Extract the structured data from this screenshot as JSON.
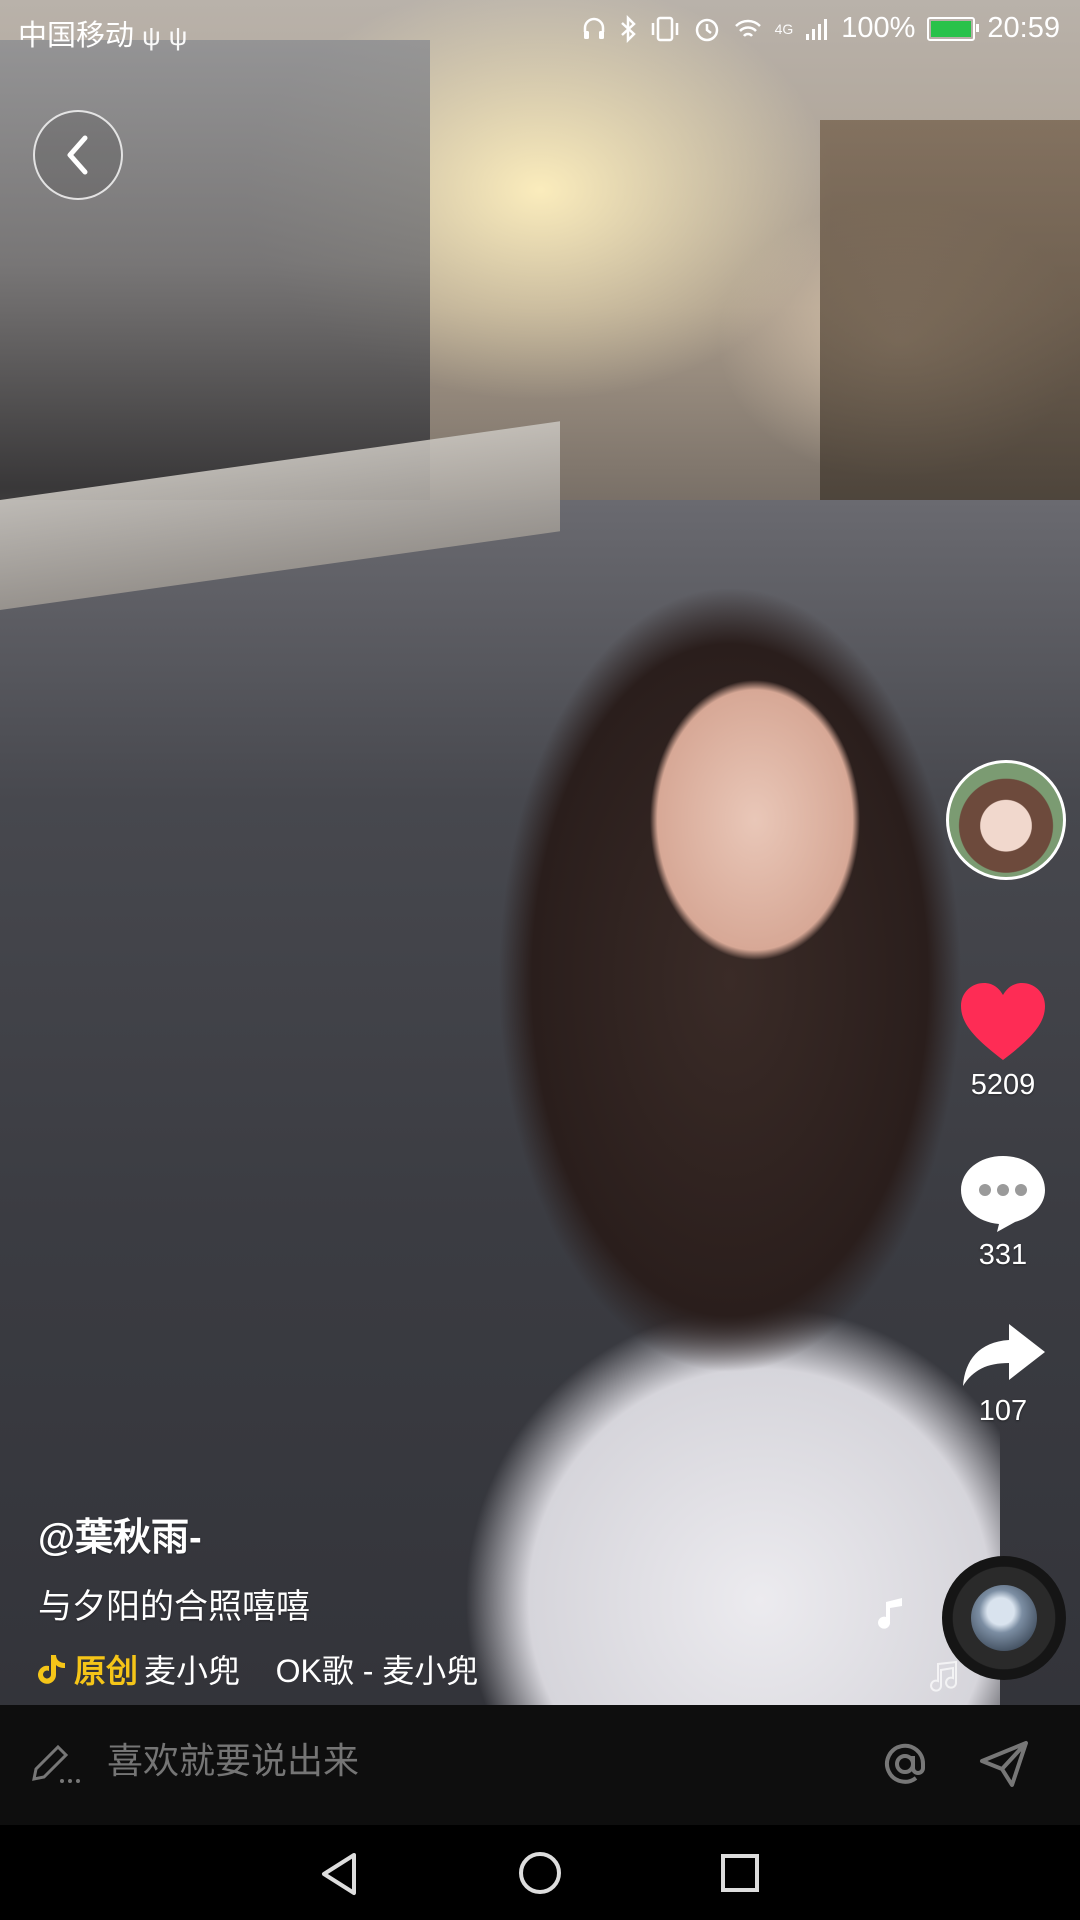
{
  "status_bar": {
    "carrier": "中国移动",
    "battery": "100%",
    "time": "20:59",
    "battery_color": "#29c24a",
    "icons": [
      "usb-icon",
      "usb-icon",
      "headset-icon",
      "bluetooth-icon",
      "vibrate-icon",
      "alarm-icon",
      "wifi-icon",
      "signal-icon",
      "battery-icon"
    ],
    "network_label": "4G"
  },
  "actions": {
    "likes": "5209",
    "comments": "331",
    "shares": "107",
    "like_color": "#fe2c55"
  },
  "post": {
    "username": "@葉秋雨-",
    "description": "与夕阳的合照嘻嘻",
    "music_original_label": "原创",
    "music_marquee": "麦小兜    OK歌 - 麦小兜"
  },
  "comment_bar": {
    "placeholder": "喜欢就要说出来"
  }
}
